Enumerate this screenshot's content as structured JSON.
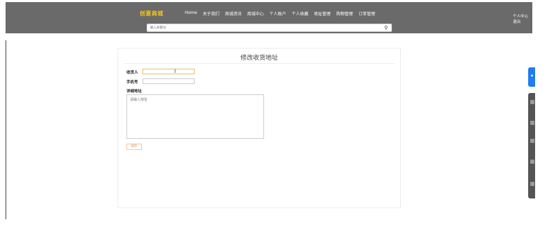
{
  "header": {
    "brand": "创意商城",
    "nav": [
      "Home",
      "关于我们",
      "商城资讯",
      "商城中心",
      "个人账户",
      "个人收藏",
      "地址管理",
      "购物管理",
      "订单管理"
    ],
    "user_center": "个人中心",
    "logout": "退出",
    "search_placeholder": "输入关键词",
    "search_icon": "search-icon"
  },
  "form": {
    "title": "修改收货地址",
    "receiver_label": "收货人",
    "receiver_value": "",
    "phone_label": "手机号",
    "phone_value": "",
    "address_label": "详细地址",
    "address_placeholder": "请输入地址",
    "save_label": "保存"
  },
  "colors": {
    "header_bg": "#6a6a6a",
    "brand": "#f5c518",
    "save_border": "#f0c9a2",
    "side_tab": "#1f7cf2"
  }
}
